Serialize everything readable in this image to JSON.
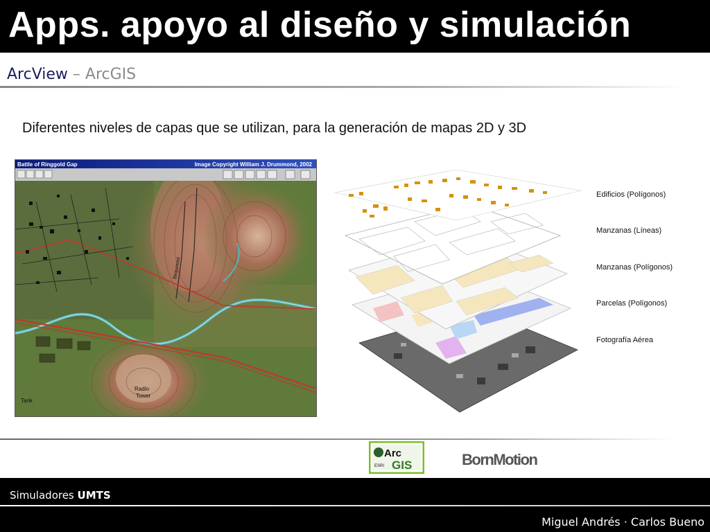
{
  "slide": {
    "title": "Apps. apoyo al diseño y simulación",
    "subtitle_main": "ArcView",
    "subtitle_sep": " – ",
    "subtitle_second": "ArcGIS",
    "description": "Diferentes niveles de capas que se utilizan, para la generación de mapas 2D y 3D"
  },
  "map_window": {
    "title_left": "Battle of Ringgold Gap",
    "title_right": "Image Copyright William J. Drummond, 2002",
    "map_labels": [
      "Radio",
      "Tower",
      "Tank",
      "Beaumont"
    ]
  },
  "layers": {
    "items": [
      {
        "label": "Edificios (Polígonos)"
      },
      {
        "label": "Manzanas (Líneas)"
      },
      {
        "label": "Manzanas (Polígonos)"
      },
      {
        "label": "Parcelas (Polígonos)"
      },
      {
        "label": "Fotografía Aérea"
      }
    ]
  },
  "logos": {
    "arcgis_arc": "Arc",
    "arcgis_esri": "ESRI",
    "arcgis_gis": "GIS",
    "bornmotion": "BornMotion"
  },
  "footer": {
    "left_prefix": "Simuladores ",
    "left_bold": "UMTS",
    "right": "Miguel Andrés · Carlos Bueno"
  },
  "colors": {
    "title_bg": "#000000",
    "subtitle_main": "#1a1f5c",
    "subtitle_second": "#8a8a8a",
    "arcgis_border": "#7bbf2a",
    "arcgis_gis": "#2e7d1f"
  }
}
